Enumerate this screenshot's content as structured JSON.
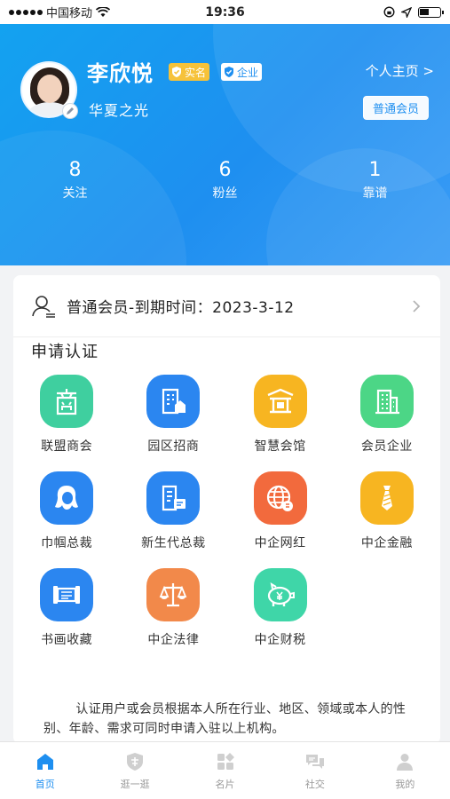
{
  "status_bar": {
    "carrier": "中国移动",
    "time": "19:36"
  },
  "profile": {
    "name": "李欣悦",
    "badge_real": "实名",
    "badge_enterprise": "企业",
    "company": "华夏之光",
    "home_link": "个人主页 >",
    "member_button": "普通会员"
  },
  "stats": [
    {
      "value": "8",
      "label": "关注"
    },
    {
      "value": "6",
      "label": "粉丝"
    },
    {
      "value": "1",
      "label": "靠谱"
    }
  ],
  "membership": {
    "text": "普通会员-到期时间：2023-3-12"
  },
  "section": {
    "title": "申请认证"
  },
  "grid_items": [
    {
      "label": "联盟商会",
      "icon": "shop-icon",
      "color": "#3fcf9f"
    },
    {
      "label": "园区招商",
      "icon": "building-park-icon",
      "color": "#2b86f0"
    },
    {
      "label": "智慧会馆",
      "icon": "pavilion-icon",
      "color": "#f7b521"
    },
    {
      "label": "会员企业",
      "icon": "office-building-icon",
      "color": "#4cd686"
    },
    {
      "label": "巾帼总裁",
      "icon": "woman-icon",
      "color": "#2b86f0"
    },
    {
      "label": "新生代总裁",
      "icon": "new-generation-icon",
      "color": "#2b86f0"
    },
    {
      "label": "中企网红",
      "icon": "globe-icon",
      "color": "#f26a3d"
    },
    {
      "label": "中企金融",
      "icon": "tie-icon",
      "color": "#f7b521"
    },
    {
      "label": "书画收藏",
      "icon": "scroll-icon",
      "color": "#2b86f0"
    },
    {
      "label": "中企法律",
      "icon": "scales-icon",
      "color": "#f2894a"
    },
    {
      "label": "中企财税",
      "icon": "piggy-bank-icon",
      "color": "#3fd6a8"
    }
  ],
  "note": "认证用户或会员根据本人所在行业、地区、领域或本人的性别、年龄、需求可同时申请入驻以上机构。",
  "tabs": [
    {
      "label": "首页",
      "icon": "home-icon",
      "active": true
    },
    {
      "label": "逛一逛",
      "icon": "stroll-icon",
      "active": false
    },
    {
      "label": "名片",
      "icon": "card-grid-icon",
      "active": false
    },
    {
      "label": "社交",
      "icon": "chat-icon",
      "active": false
    },
    {
      "label": "我的",
      "icon": "person-icon",
      "active": false
    }
  ]
}
